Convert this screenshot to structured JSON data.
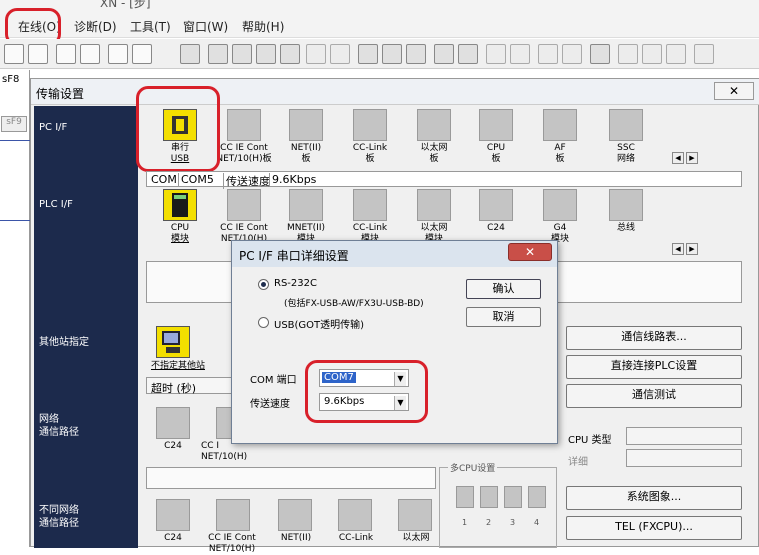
{
  "menubar": {
    "title_fragment": "XN - [步]",
    "items": [
      "在线(O)",
      "诊断(D)",
      "工具(T)",
      "窗口(W)",
      "帮助(H)"
    ]
  },
  "left_strip": {
    "key1": "sF8",
    "key2": "sF9"
  },
  "dialog": {
    "title": "传输设置",
    "close": "✕",
    "pc_if": {
      "label": "PC I/F",
      "icons": [
        {
          "line1": "串行",
          "line2": "USB"
        },
        {
          "line1": "CC IE Cont",
          "line2": "NET/10(H)板"
        },
        {
          "line1": "NET(II)",
          "line2": "板"
        },
        {
          "line1": "CC-Link",
          "line2": "板"
        },
        {
          "line1": "以太网",
          "line2": "板"
        },
        {
          "line1": "CPU",
          "line2": "板"
        },
        {
          "line1": "AF",
          "line2": "板"
        },
        {
          "line1": "SSC",
          "line2": "网络"
        }
      ],
      "status": {
        "com_label": "COM",
        "com_value": "COM5",
        "speed_label": "传送速度",
        "speed_value": "9.6Kbps"
      }
    },
    "plc_if": {
      "label": "PLC I/F",
      "icons": [
        {
          "line1": "CPU",
          "line2": "模块"
        },
        {
          "line1": "CC IE Cont",
          "line2": "NET/10(H)"
        },
        {
          "line1": "MNET(II)",
          "line2": "模块"
        },
        {
          "line1": "CC-Link",
          "line2": "模块"
        },
        {
          "line1": "以太网",
          "line2": "模块"
        },
        {
          "line1": "C24",
          "line2": ""
        },
        {
          "line1": "G4",
          "line2": "模块"
        },
        {
          "line1": "总线",
          "line2": ""
        }
      ]
    },
    "other_station": {
      "label": "其他站指定",
      "icon_label": "不指定其他站",
      "timeout_label": "超时 (秒)"
    },
    "network_route": {
      "label1": "网络",
      "label2": "通信路径",
      "icons": [
        {
          "line1": "C24",
          "line2": ""
        },
        {
          "line1": "CC I",
          "line2": "NET/10(H)"
        }
      ]
    },
    "diff_network": {
      "label1": "不同网络",
      "label2": "通信路径",
      "icons": [
        {
          "line1": "C24",
          "line2": ""
        },
        {
          "line1": "CC IE Cont",
          "line2": "NET/10(H)"
        },
        {
          "line1": "NET(II)",
          "line2": ""
        },
        {
          "line1": "CC-Link",
          "line2": ""
        },
        {
          "line1": "以太网",
          "line2": ""
        }
      ]
    },
    "right_buttons": [
      "通信线路表...",
      "直接连接PLC设置",
      "通信测试",
      "系统图象...",
      "TEL (FXCPU)..."
    ],
    "cpu_type_label": "CPU 类型",
    "detail_label": "详细",
    "multi_cpu": {
      "title": "多CPU设置",
      "nums": [
        "1",
        "2",
        "3",
        "4"
      ]
    }
  },
  "popup": {
    "title": "PC I/F 串口详细设置",
    "close": "✕",
    "rs232c": "RS-232C",
    "rs232c_note": "(包括FX-USB-AW/FX3U-USB-BD)",
    "usb": "USB(GOT透明传输)",
    "ok": "确认",
    "cancel": "取消",
    "com_port_label": "COM 端口",
    "com_port_value": "COM7",
    "speed_label": "传送速度",
    "speed_value": "9.6Kbps"
  },
  "colors": {
    "navy": "#1c2a4c",
    "highlight": "#d8202a",
    "yellow": "#f3df00"
  }
}
